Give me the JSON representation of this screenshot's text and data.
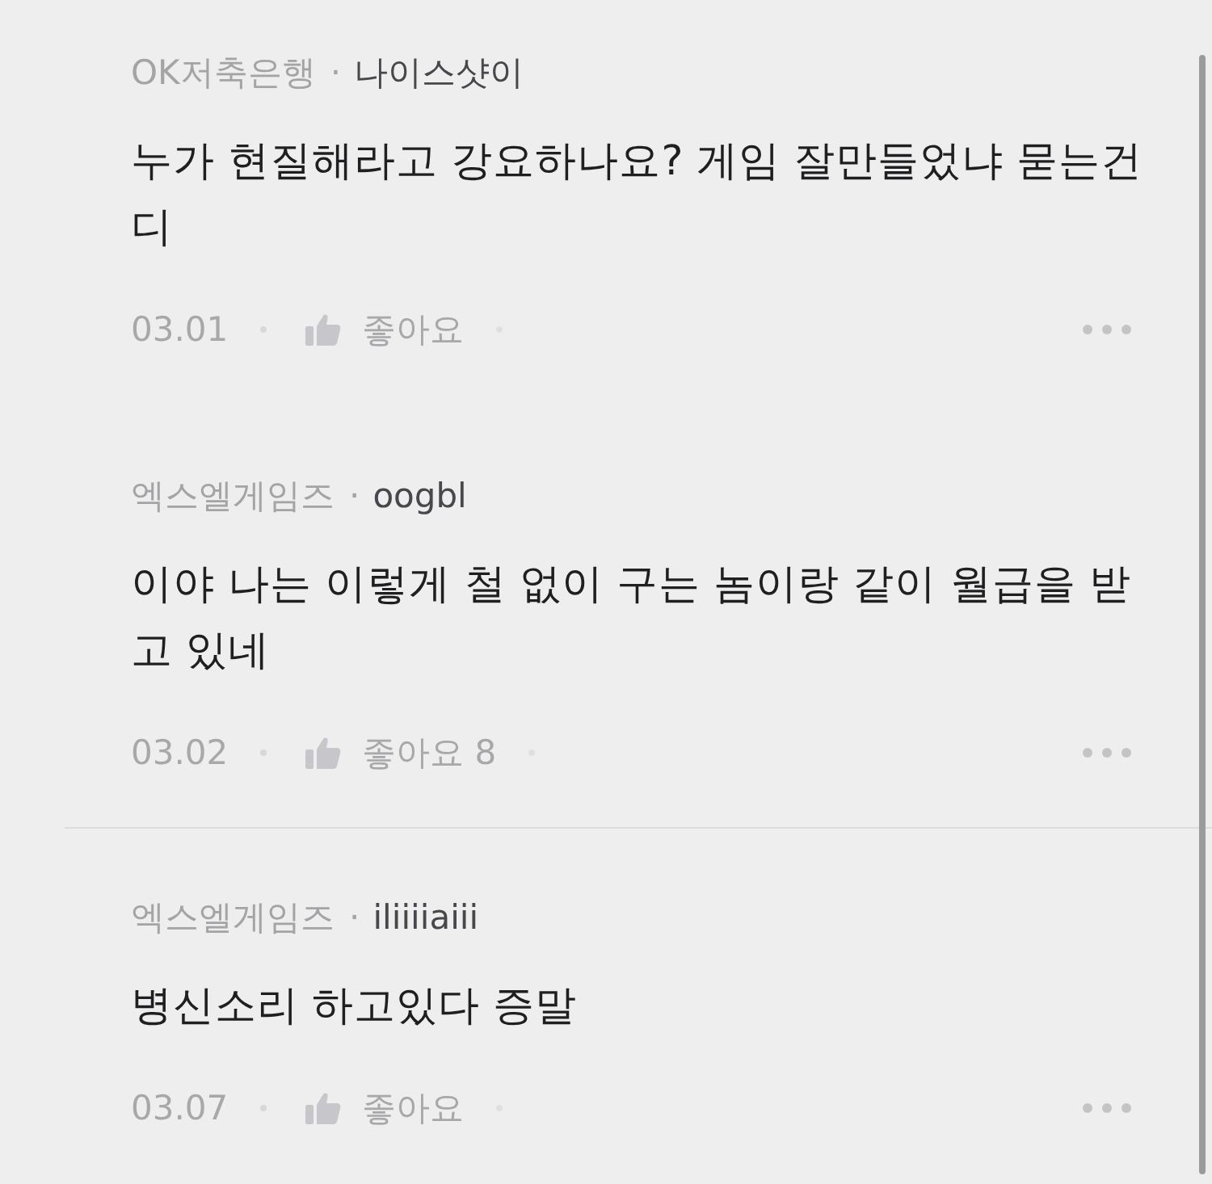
{
  "comments": [
    {
      "company": "OK저축은행",
      "separator": "·",
      "author": "나이스샷이",
      "text": "누가 현질해라고 강요하나요? 게임 잘만들었냐 묻는건디",
      "date": "03.01",
      "like_label": "좋아요",
      "divider_above": false
    },
    {
      "company": "엑스엘게임즈",
      "separator": "·",
      "author": "oogbl",
      "text": "이야 나는 이렇게 철 없이 구는 놈이랑 같이 월급을 받고 있네",
      "date": "03.02",
      "like_label": "좋아요",
      "like_count": "8",
      "divider_above": false
    },
    {
      "company": "엑스엘게임즈",
      "separator": "·",
      "author": "iliiiiaiii",
      "text": "병신소리 하고있다 증말",
      "date": "03.07",
      "like_label": "좋아요",
      "divider_above": true
    }
  ]
}
